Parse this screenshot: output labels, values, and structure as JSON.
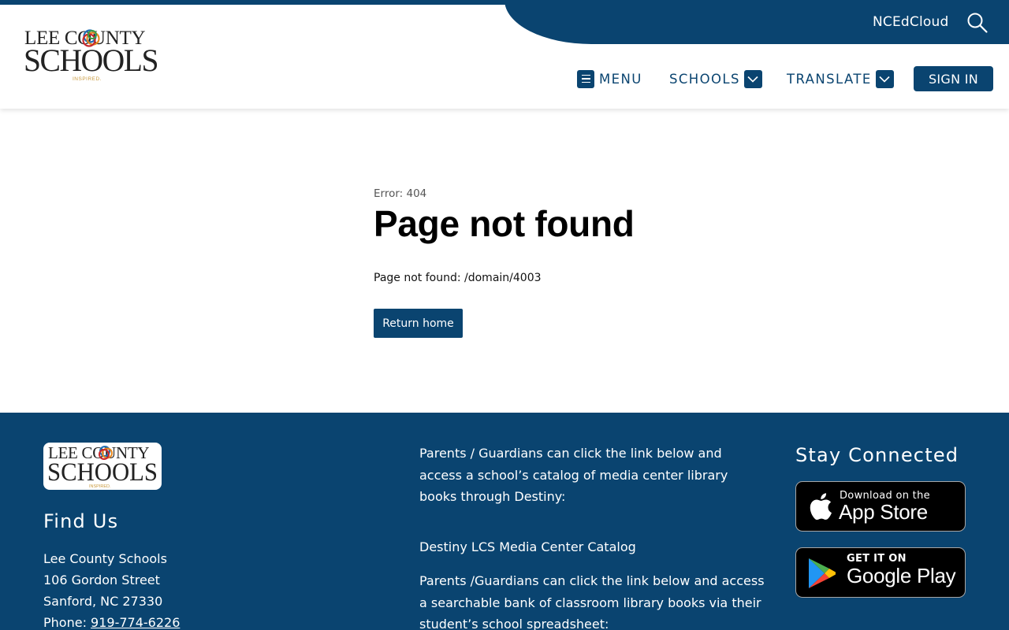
{
  "header": {
    "logo_line1": "LEE COUNTY",
    "logo_line2": "SCHOOLS",
    "logo_tagline": "INSPIRED.",
    "utility_link": "NCEdCloud",
    "search_icon": "search-icon",
    "nav": {
      "menu": "MENU",
      "schools": "SCHOOLS",
      "translate": "TRANSLATE"
    },
    "sign_in": "SIGN IN"
  },
  "main": {
    "error_code": "Error: 404",
    "title": "Page not found",
    "message": "Page not found: /domain/4003",
    "return_button": "Return home"
  },
  "footer": {
    "find_us_heading": "Find Us",
    "address": {
      "name": "Lee County Schools",
      "street": "106 Gordon Street",
      "city": "Sanford, NC 27330",
      "phone_label": "Phone: ",
      "phone": "919-774-6226"
    },
    "text1": "Parents / Guardians can click the link below and access a school’s catalog of media center library books through Destiny:",
    "destiny_link": "Destiny LCS Media Center Catalog",
    "text2": "Parents /Guardians can click the link below and access a searchable bank of classroom library books via their student’s school spreadsheet:",
    "stay_connected_heading": "Stay Connected",
    "app_store": {
      "small": "Download on the",
      "big": "App Store"
    },
    "google_play": {
      "small": "GET IT ON",
      "big": "Google Play"
    }
  },
  "colors": {
    "brand_navy": "#0a4470",
    "logo_blue": "#1f6fb5",
    "logo_orange": "#e8871e",
    "logo_red": "#c8282e",
    "logo_green": "#3a9d47"
  }
}
